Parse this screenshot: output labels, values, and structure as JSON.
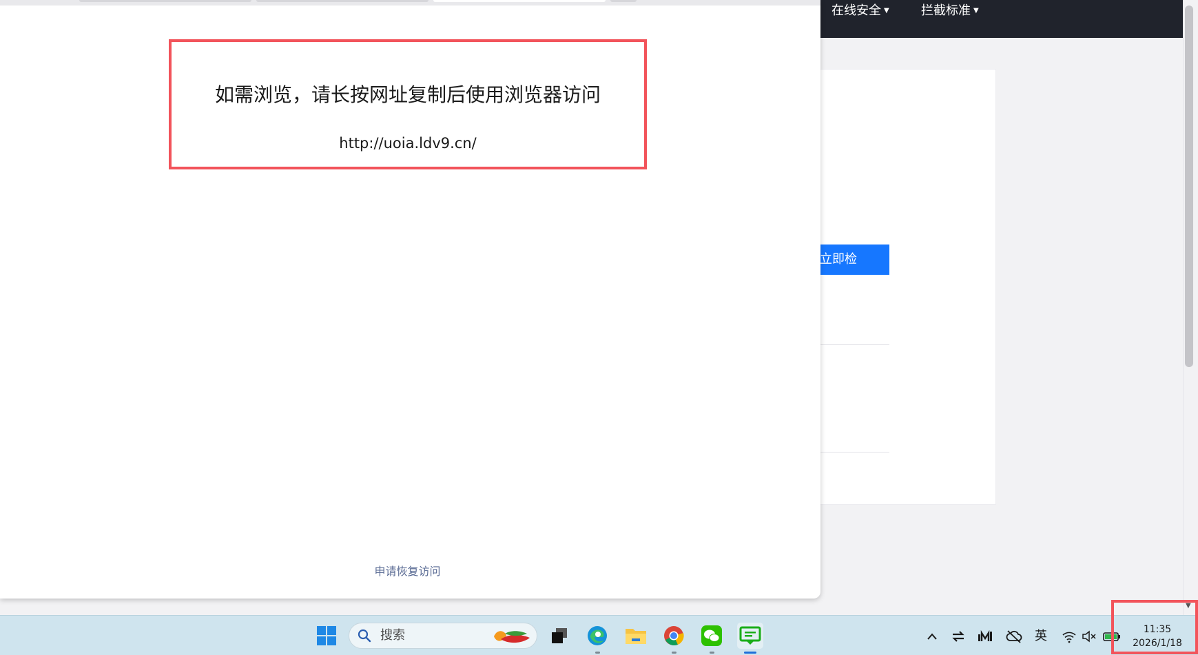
{
  "background_page": {
    "nav_items": [
      "在线安全",
      "拦截标准"
    ],
    "detect_button": "立即检测"
  },
  "popup": {
    "message_title": "如需浏览，请长按网址复制后使用浏览器访问",
    "message_url": "http://uoia.ldv9.cn/",
    "recover_link": "申请恢复访问"
  },
  "taskbar": {
    "search_placeholder": "搜索",
    "apps": [
      "start-icon",
      "task-view-icon",
      "edge-icon",
      "file-explorer-icon",
      "chrome-icon",
      "wechat-icon",
      "chat-icon"
    ],
    "tray": {
      "input_method": "英",
      "time": "11:35",
      "date": "2026/1/18"
    }
  },
  "colors": {
    "highlight_border": "#f2545b",
    "nav_bg": "#20232c",
    "button_blue": "#1677ff",
    "taskbar_bg": "#cfe4ee",
    "link": "#5a6b94"
  }
}
